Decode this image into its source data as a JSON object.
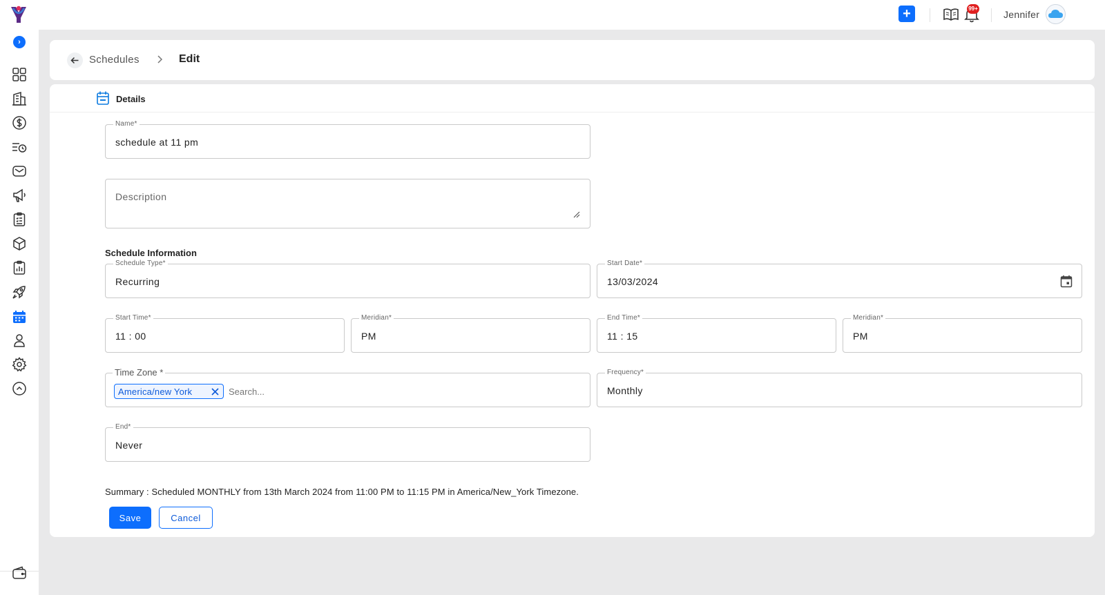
{
  "header": {
    "user_name": "Jennifer",
    "notification_badge": "99+",
    "accent_color": "#0d6efd"
  },
  "sidebar": {
    "icons": [
      "grid-icon",
      "building-icon",
      "dollar-icon",
      "list-clock-icon",
      "mail-icon",
      "megaphone-icon",
      "clipboard-icon",
      "box-icon",
      "report-icon",
      "rocket-icon",
      "calendar-icon",
      "user-icon",
      "settings-icon",
      "chevron-up-icon",
      "wallet-icon"
    ],
    "active_icon": "calendar-icon"
  },
  "breadcrumb": {
    "parent": "Schedules",
    "current": "Edit"
  },
  "tab": {
    "label": "Details"
  },
  "form": {
    "name": {
      "label": "Name*",
      "value": "schedule at 11 pm"
    },
    "description": {
      "placeholder": "Description"
    },
    "section_title": "Schedule Information",
    "schedule_type": {
      "label": "Schedule Type*",
      "value": "Recurring"
    },
    "start_date": {
      "label": "Start Date*",
      "value": "13/03/2024"
    },
    "start_time": {
      "label": "Start Time*",
      "value": "11 : 00"
    },
    "start_meridian": {
      "label": "Meridian*",
      "value": "PM"
    },
    "end_time": {
      "label": "End Time*",
      "value": "11 : 15"
    },
    "end_meridian": {
      "label": "Meridian*",
      "value": "PM"
    },
    "time_zone": {
      "label": "Time Zone *",
      "chip": "America/new York",
      "search_placeholder": "Search..."
    },
    "frequency": {
      "label": "Frequency*",
      "value": "Monthly"
    },
    "end": {
      "label": "End*",
      "value": "Never"
    }
  },
  "summary": "Summary : Scheduled MONTHLY from 13th March 2024 from 11:00 PM to 11:15 PM in America/New_York Timezone.",
  "actions": {
    "save": "Save",
    "cancel": "Cancel"
  }
}
